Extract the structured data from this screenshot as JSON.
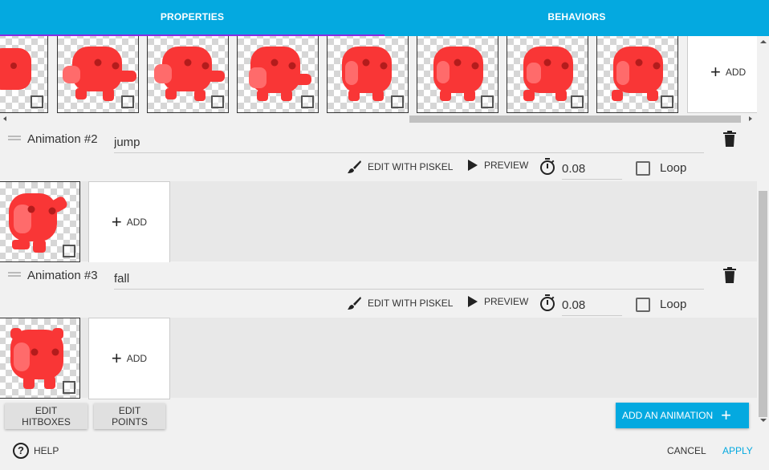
{
  "tabs": {
    "properties": "PROPERTIES",
    "behaviors": "BEHAVIORS"
  },
  "top_strip": {
    "add_label": "ADD"
  },
  "animations": [
    {
      "label": "Animation #2",
      "name": "jump",
      "edit_with_piskel": "EDIT WITH PISKEL",
      "preview": "PREVIEW",
      "timer": "0.08",
      "loop_label": "Loop",
      "add_label": "ADD"
    },
    {
      "label": "Animation #3",
      "name": "fall",
      "edit_with_piskel": "EDIT WITH PISKEL",
      "preview": "PREVIEW",
      "timer": "0.08",
      "loop_label": "Loop",
      "add_label": "ADD"
    }
  ],
  "actions": {
    "edit_hitboxes": "EDIT HITBOXES",
    "edit_points": "EDIT POINTS",
    "add_animation": "ADD AN ANIMATION"
  },
  "footer": {
    "help": "HELP",
    "cancel": "CANCEL",
    "apply": "APPLY"
  },
  "colors": {
    "accent": "#04a9e0",
    "tab_indicator": "#8b2be2",
    "sprite": "#f93636"
  }
}
